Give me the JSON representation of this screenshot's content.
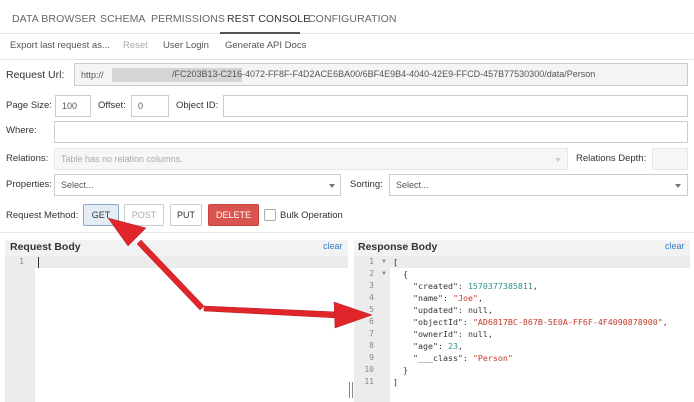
{
  "tabs": [
    "DATA BROWSER",
    "SCHEMA",
    "PERMISSIONS",
    "REST CONSOLE",
    "CONFIGURATION"
  ],
  "actions": {
    "export": "Export last request as...",
    "reset": "Reset",
    "user_login": "User Login",
    "generate_docs": "Generate API Docs"
  },
  "request_url": {
    "label": "Request Url:",
    "prefix": "http://",
    "path": "/FC203B13-C216-4072-FF8F-F4D2ACE6BA00/6BF4E9B4-4040-42E9-FFCD-457B77530300/data/Person"
  },
  "page_size": {
    "label": "Page Size:",
    "value": "100"
  },
  "offset": {
    "label": "Offset:",
    "value": "0"
  },
  "object_id": {
    "label": "Object ID:",
    "value": ""
  },
  "where": {
    "label": "Where:",
    "value": ""
  },
  "relations": {
    "label": "Relations:",
    "placeholder": "Table has no relation columns."
  },
  "relations_depth": {
    "label": "Relations Depth:",
    "value": ""
  },
  "properties": {
    "label": "Properties:",
    "placeholder": "Select..."
  },
  "sorting": {
    "label": "Sorting:",
    "placeholder": "Select..."
  },
  "request_method": {
    "label": "Request Method:",
    "buttons": [
      "GET",
      "POST",
      "PUT",
      "DELETE"
    ],
    "bulk_label": "Bulk Operation"
  },
  "request_body": {
    "title": "Request Body",
    "clear": "clear",
    "line_numbers": [
      "1"
    ]
  },
  "response_body": {
    "title": "Response Body",
    "clear": "clear",
    "line_numbers": [
      "1",
      "2",
      "3",
      "4",
      "5",
      "6",
      "7",
      "8",
      "9",
      "10",
      "11"
    ],
    "lines": [
      "[",
      "  {",
      "    \"created\": 1570377385811,",
      "    \"name\": \"Joe\",",
      "    \"updated\": null,",
      "    \"objectId\": \"AD6817BC-867B-5E0A-FF6F-4F4090878900\",",
      "    \"ownerId\": null,",
      "    \"age\": 23,",
      "    \"___class\": \"Person\"",
      "  }",
      "]"
    ]
  },
  "colors": {
    "arrow": "#e0262b",
    "delete": "#d9534f",
    "link": "#3a7bbf"
  }
}
